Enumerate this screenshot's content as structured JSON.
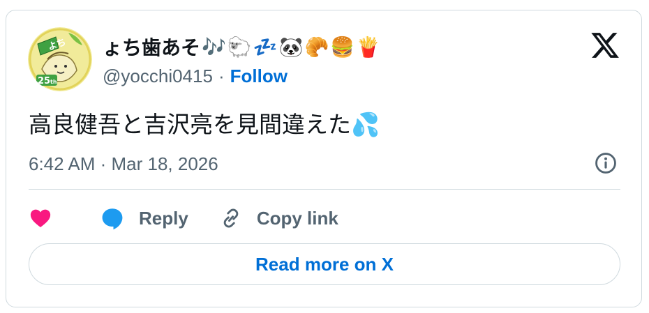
{
  "author": {
    "display_name": "ょち歯あそ",
    "name_emojis": [
      "🎶",
      "🐑",
      "💤",
      "🐼",
      "🥐",
      "🍔",
      "🍟"
    ],
    "handle": "@yocchi0415",
    "separator": "·",
    "follow_label": "Follow",
    "avatar_text": "よち",
    "avatar_badge": "25",
    "avatar_badge_suffix": "th"
  },
  "tweet": {
    "text": "高良健吾と吉沢亮を見間違えた",
    "trailing_emoji": "💦",
    "timestamp": "6:42 AM · Mar 18, 2026"
  },
  "actions": {
    "reply_label": "Reply",
    "copy_link_label": "Copy link",
    "read_more_label": "Read more on X"
  },
  "colors": {
    "link": "#006fd6",
    "muted": "#536471",
    "like": "#f91880",
    "reply": "#1d9bf0",
    "border": "#cfd9de"
  }
}
